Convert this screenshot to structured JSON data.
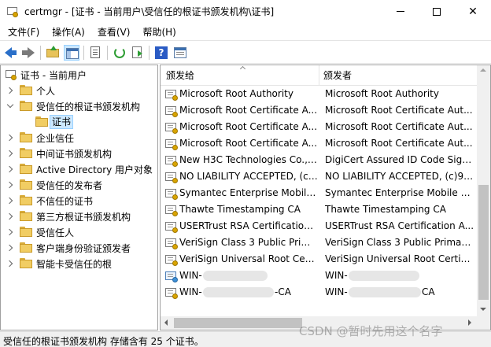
{
  "window": {
    "title": "certmgr - [证书 - 当前用户\\受信任的根证书颁发机构\\证书]"
  },
  "menu": [
    "文件(F)",
    "操作(A)",
    "查看(V)",
    "帮助(H)"
  ],
  "toolbar": {
    "icons": [
      "back-arrow-icon",
      "forward-arrow-icon",
      "up-folder-icon",
      "show-hide-tree-icon",
      "properties-sheet-icon",
      "refresh-icon",
      "export-list-icon",
      "help-icon",
      "properties-pane-icon"
    ]
  },
  "tree": {
    "root": "证书 - 当前用户",
    "items": [
      {
        "label": "个人",
        "expandable": true,
        "expanded": false
      },
      {
        "label": "受信任的根证书颁发机构",
        "expandable": true,
        "expanded": true
      },
      {
        "label": "证书",
        "expandable": false,
        "selected": true
      },
      {
        "label": "企业信任",
        "expandable": true,
        "expanded": false
      },
      {
        "label": "中间证书颁发机构",
        "expandable": true,
        "expanded": false
      },
      {
        "label": "Active Directory 用户对象",
        "expandable": true,
        "expanded": false
      },
      {
        "label": "受信任的发布者",
        "expandable": true,
        "expanded": false
      },
      {
        "label": "不信任的证书",
        "expandable": true,
        "expanded": false
      },
      {
        "label": "第三方根证书颁发机构",
        "expandable": true,
        "expanded": false
      },
      {
        "label": "受信任人",
        "expandable": true,
        "expanded": false
      },
      {
        "label": "客户端身份验证颁发者",
        "expandable": true,
        "expanded": false
      },
      {
        "label": "智能卡受信任的根",
        "expandable": true,
        "expanded": false
      }
    ]
  },
  "list": {
    "columns": [
      "颁发给",
      "颁发者"
    ],
    "rows": [
      {
        "issued_to": "Microsoft Root Authority",
        "issued_by": "Microsoft Root Authority"
      },
      {
        "issued_to": "Microsoft Root Certificate A...",
        "issued_by": "Microsoft Root Certificate Aut..."
      },
      {
        "issued_to": "Microsoft Root Certificate A...",
        "issued_by": "Microsoft Root Certificate Aut..."
      },
      {
        "issued_to": "Microsoft Root Certificate A...",
        "issued_by": "Microsoft Root Certificate Aut..."
      },
      {
        "issued_to": "New H3C Technologies Co., ...",
        "issued_by": "DigiCert Assured ID Code Sign..."
      },
      {
        "issued_to": "NO LIABILITY ACCEPTED, (c)...",
        "issued_by": "NO LIABILITY ACCEPTED, (c)97..."
      },
      {
        "issued_to": "Symantec Enterprise Mobile ...",
        "issued_by": "Symantec Enterprise Mobile R..."
      },
      {
        "issued_to": "Thawte Timestamping CA",
        "issued_by": "Thawte Timestamping CA"
      },
      {
        "issued_to": "USERTrust RSA Certification ...",
        "issued_by": "USERTrust RSA Certification A..."
      },
      {
        "issued_to": "VeriSign Class 3 Public Prim...",
        "issued_by": "VeriSign Class 3 Public Primary..."
      },
      {
        "issued_to": "VeriSign Universal Root Cert...",
        "issued_by": "VeriSign Universal Root Certifi..."
      },
      {
        "issued_to": "WIN-",
        "issued_by": "WIN-",
        "redacted": true
      },
      {
        "issued_to": "WIN-",
        "issued_to_suffix": "-CA",
        "issued_by": "WIN-",
        "issued_by_suffix": "CA",
        "redacted": true
      }
    ]
  },
  "status": {
    "text": "受信任的根证书颁发机构 存储含有 25 个证书。"
  },
  "watermark": "CSDN @暂时先用这个名字"
}
